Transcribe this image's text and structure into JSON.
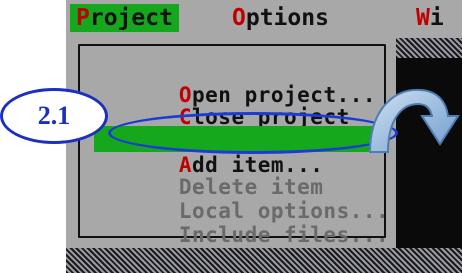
{
  "menubar": {
    "project": {
      "hot": "P",
      "rest": "roject"
    },
    "options": {
      "hot": "O",
      "rest": "ptions"
    },
    "window_partial": {
      "hot": "W",
      "rest": "i"
    }
  },
  "dropdown": {
    "items": [
      {
        "hot": "O",
        "rest": "pen project...",
        "state": "enabled"
      },
      {
        "hot": "C",
        "rest": "lose project",
        "state": "enabled"
      },
      {
        "hot": "A",
        "rest": "dd item...",
        "state": "selected"
      },
      {
        "hot": "",
        "rest": "Delete item",
        "state": "disabled"
      },
      {
        "hot": "",
        "rest": "Local options...",
        "state": "disabled"
      },
      {
        "hot": "",
        "rest": "Include files...",
        "state": "disabled"
      }
    ]
  },
  "annotation": {
    "callout_label": "2.1",
    "callout_color": "#1c2fbf",
    "highlight_color": "#15a81c",
    "hotkey_color": "#c00000",
    "arrow_icon": "curved-arrow-icon"
  }
}
